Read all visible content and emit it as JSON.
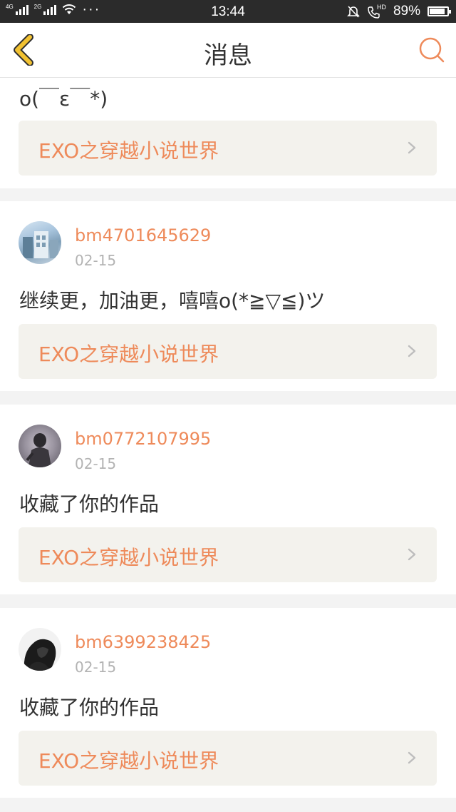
{
  "status_bar": {
    "network_1": "4G",
    "network_2": "2G",
    "more": "···",
    "time": "13:44",
    "hd_label": "HD",
    "battery_text": "89%",
    "battery_level": 0.89
  },
  "header": {
    "title": "消息"
  },
  "messages": [
    {
      "text": "o(￣ε￣*)",
      "link_title": "EXO之穿越小说世界"
    },
    {
      "username": "bm4701645629",
      "date": "02-15",
      "text": "继续更，加油更，嘻嘻o(*≧▽≦)ツ",
      "link_title": "EXO之穿越小说世界"
    },
    {
      "username": "bm0772107995",
      "date": "02-15",
      "text": "收藏了你的作品",
      "link_title": "EXO之穿越小说世界"
    },
    {
      "username": "bm6399238425",
      "date": "02-15",
      "text": "收藏了你的作品",
      "link_title": "EXO之穿越小说世界"
    }
  ],
  "colors": {
    "accent": "#ee8a5a",
    "back_arrow": "#f2c232",
    "link_bg": "#f3f2ed"
  }
}
